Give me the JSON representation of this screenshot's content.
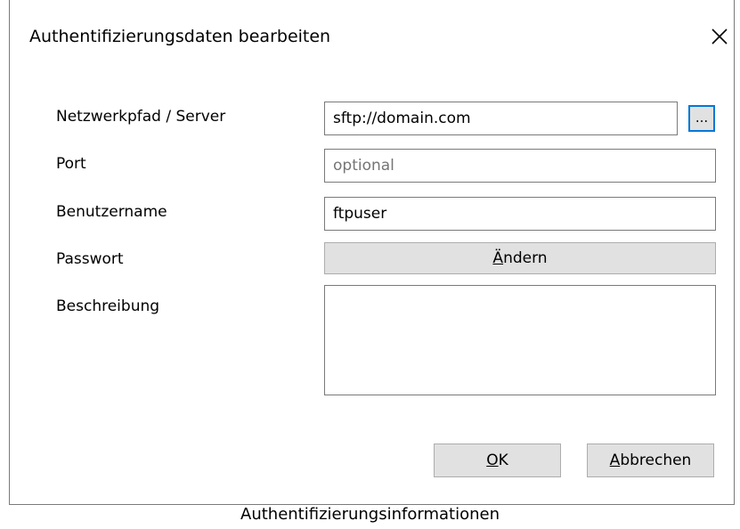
{
  "dialog": {
    "title": "Authentifizierungsdaten bearbeiten",
    "close_icon": "close-icon"
  },
  "form": {
    "server": {
      "label": "Netzwerkpfad / Server",
      "value": "sftp://domain.com",
      "browse_label": "..."
    },
    "port": {
      "label": "Port",
      "placeholder": "optional",
      "value": ""
    },
    "username": {
      "label": "Benutzername",
      "value": "ftpuser"
    },
    "password": {
      "label": "Passwort",
      "change_button": {
        "mnemonic": "Ä",
        "rest": "ndern"
      }
    },
    "description": {
      "label": "Beschreibung",
      "value": ""
    }
  },
  "buttons": {
    "ok": {
      "mnemonic": "O",
      "rest": "K"
    },
    "cancel": {
      "mnemonic": "A",
      "rest": "bbrechen"
    }
  },
  "caption": "Authentifizierungsinformationen",
  "colors": {
    "focus_border": "#0078d7",
    "button_bg": "#e1e1e1",
    "field_border": "#7a7a7a",
    "placeholder": "#8a8a8a"
  }
}
